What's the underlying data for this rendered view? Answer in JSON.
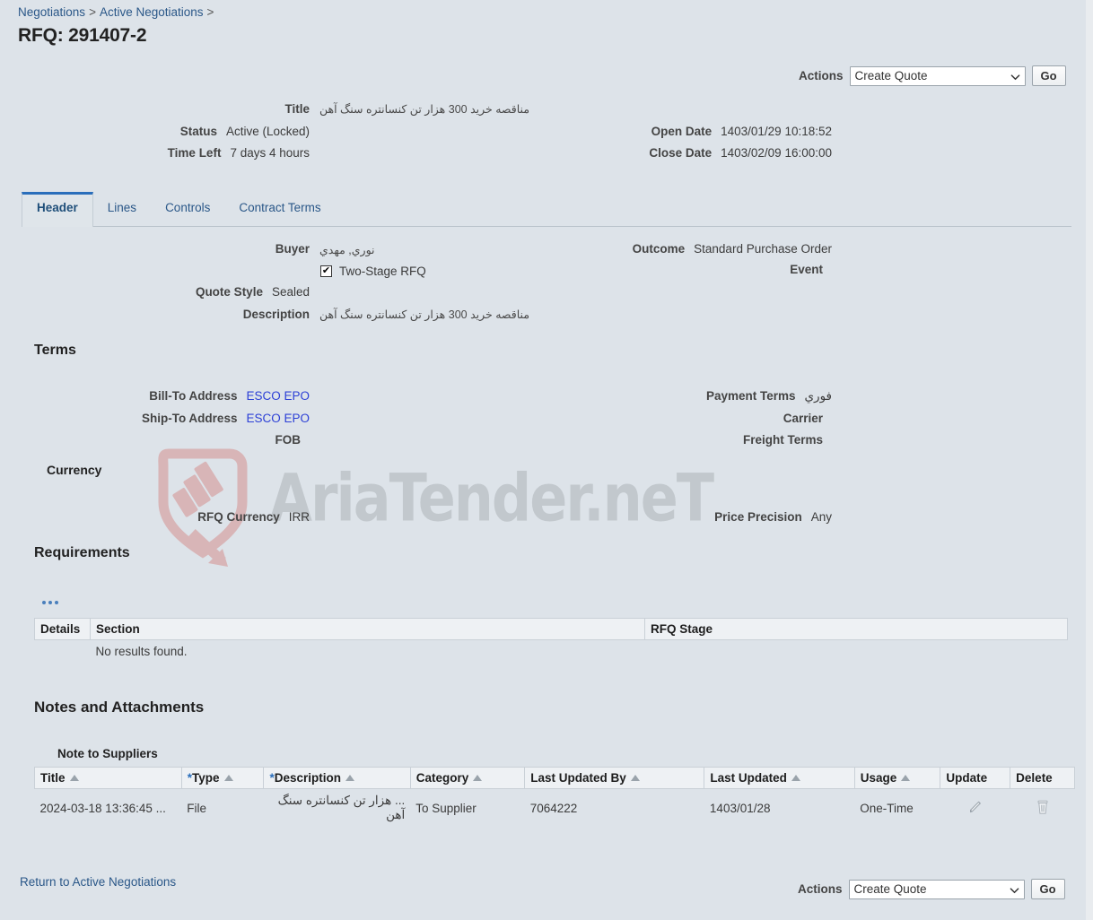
{
  "breadcrumb": {
    "items": [
      {
        "label": "Negotiations"
      },
      {
        "label": "Active Negotiations"
      }
    ],
    "separator": ">"
  },
  "page": {
    "title": "RFQ: 291407-2"
  },
  "actions_top": {
    "label": "Actions",
    "selected": "Create Quote",
    "go_label": "Go"
  },
  "actions_bottom": {
    "label": "Actions",
    "selected": "Create Quote",
    "go_label": "Go"
  },
  "summary_left": [
    {
      "key": "Title",
      "value": "مناقصه خرید 300 هزار تن کنسانتره سنگ آهن"
    },
    {
      "key": "Status",
      "value": "Active (Locked)"
    },
    {
      "key": "Time Left",
      "value": "7 days 4 hours"
    }
  ],
  "summary_right": [
    {
      "key": "Open Date",
      "value": "1403/01/29 10:18:52"
    },
    {
      "key": "Close Date",
      "value": "1403/02/09 16:00:00"
    }
  ],
  "tabs": [
    {
      "label": "Header",
      "active": true
    },
    {
      "label": "Lines",
      "active": false
    },
    {
      "label": "Controls",
      "active": false
    },
    {
      "label": "Contract Terms",
      "active": false
    }
  ],
  "header_tab": {
    "buyer_key": "Buyer",
    "buyer_value": "نوري, مهدي",
    "two_stage_label": "Two-Stage RFQ",
    "two_stage_checked": true,
    "quote_style_key": "Quote Style",
    "quote_style_value": "Sealed",
    "description_key": "Description",
    "description_value": "مناقصه خرید 300 هزار تن کنسانتره سنگ آهن",
    "outcome_key": "Outcome",
    "outcome_value": "Standard Purchase Order",
    "event_key": "Event",
    "event_value": ""
  },
  "terms": {
    "heading": "Terms",
    "bill_to_key": "Bill-To Address",
    "bill_to_value": "ESCO EPO",
    "ship_to_key": "Ship-To Address",
    "ship_to_value": "ESCO EPO",
    "fob_key": "FOB",
    "fob_value": "",
    "payment_terms_key": "Payment Terms",
    "payment_terms_value": "فوري",
    "carrier_key": "Carrier",
    "carrier_value": "",
    "freight_terms_key": "Freight Terms",
    "freight_terms_value": ""
  },
  "currency": {
    "heading": "Currency",
    "rfq_currency_key": "RFQ Currency",
    "rfq_currency_value": "IRR",
    "price_precision_key": "Price Precision",
    "price_precision_value": "Any"
  },
  "requirements": {
    "heading": "Requirements",
    "columns": [
      "Details",
      "Section",
      "RFQ Stage"
    ],
    "empty_message": "No results found."
  },
  "notes": {
    "heading": "Notes and Attachments",
    "subheading": "Note to Suppliers",
    "columns": [
      {
        "label": "Title",
        "required": false,
        "sortable": true
      },
      {
        "label": "Type",
        "required": true,
        "sortable": true
      },
      {
        "label": "Description",
        "required": true,
        "sortable": true
      },
      {
        "label": "Category",
        "required": false,
        "sortable": true
      },
      {
        "label": "Last Updated By",
        "required": false,
        "sortable": true
      },
      {
        "label": "Last Updated",
        "required": false,
        "sortable": true
      },
      {
        "label": "Usage",
        "required": false,
        "sortable": true
      },
      {
        "label": "Update",
        "required": false,
        "sortable": false
      },
      {
        "label": "Delete",
        "required": false,
        "sortable": false
      }
    ],
    "rows": [
      {
        "title": "2024-03-18 13:36:45 ...",
        "type": "File",
        "description": "... هزار تن کنسانتره سنگ آهن",
        "category": "To Supplier",
        "last_updated_by": "7064222",
        "last_updated": "1403/01/28",
        "usage": "One-Time",
        "update_icon": "pencil-icon",
        "delete_icon": "trash-icon"
      }
    ]
  },
  "footer": {
    "return_link": "Return to Active Negotiations"
  },
  "watermark": {
    "text": "AriaTender.neT",
    "logo_icon": "shield-arrow-logo"
  },
  "colors": {
    "background": "#dde3e9",
    "link": "#2a5788",
    "value_link": "#2b3fd6",
    "tab_accent": "#2a6ebb",
    "table_header": "#eef1f4",
    "watermark_text": "#c2c8cd",
    "watermark_logo": "#d4aeb0"
  }
}
